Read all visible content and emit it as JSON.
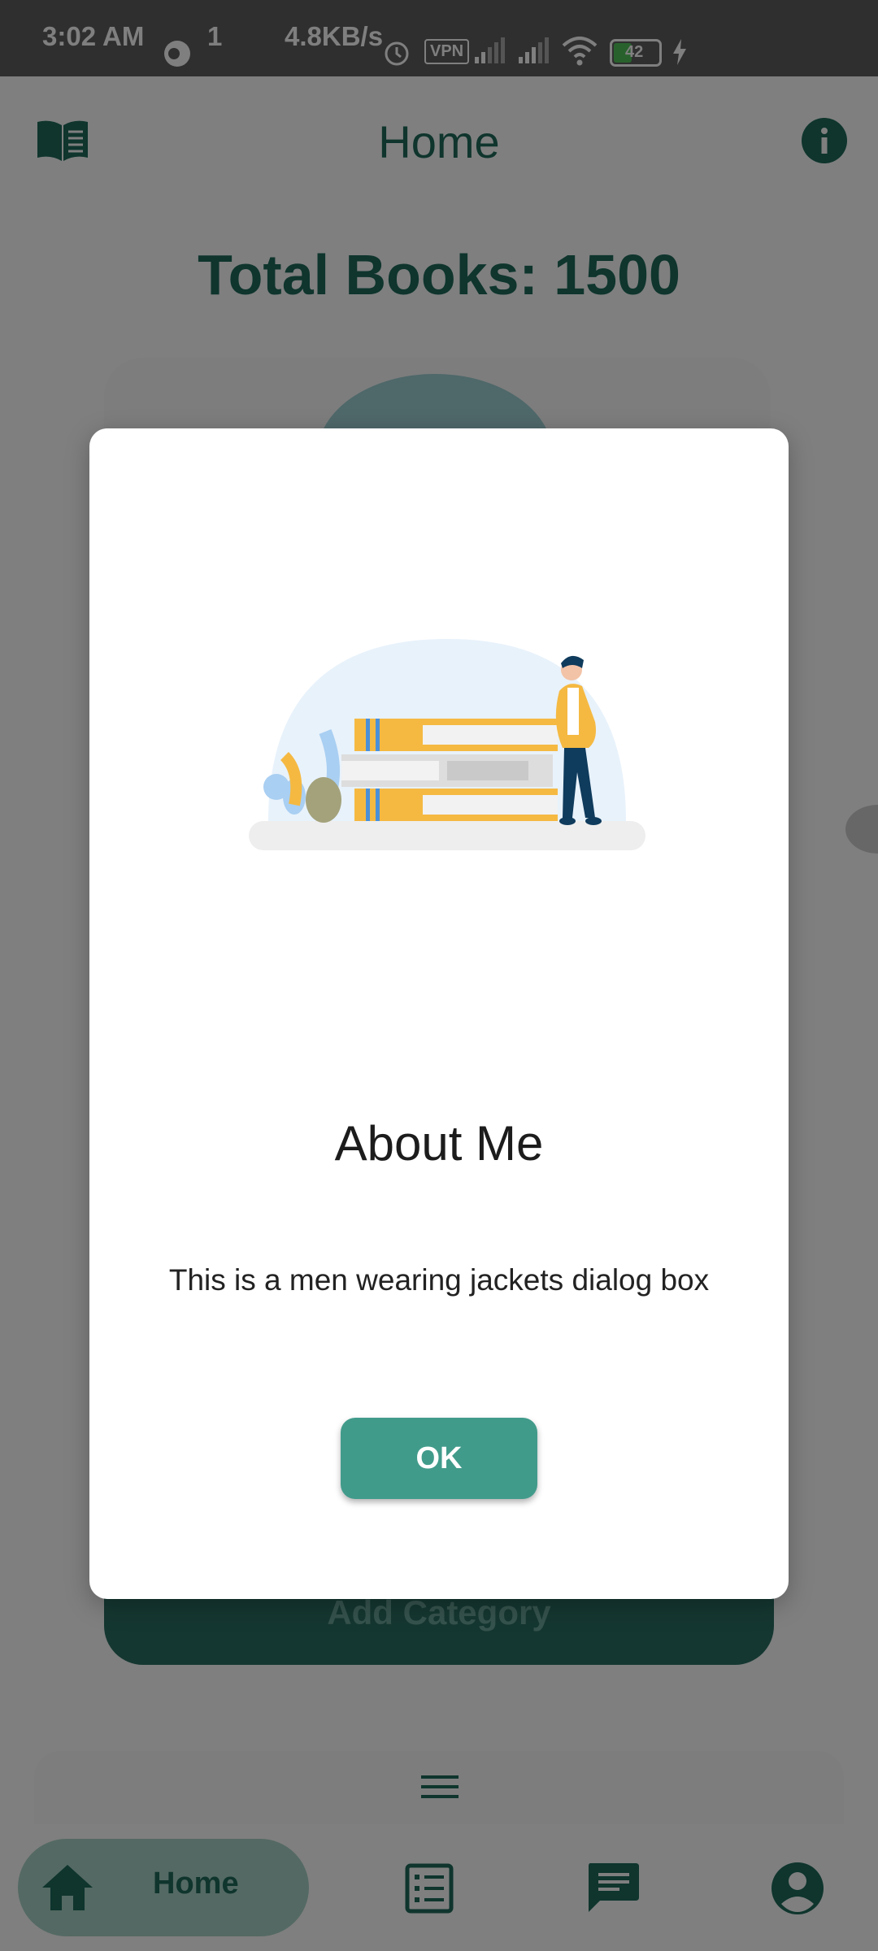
{
  "status_bar": {
    "time": "3:02 AM",
    "speed": "4.8KB/s",
    "vpn": "VPN",
    "battery": "42"
  },
  "appbar": {
    "title": "Home",
    "left_icon": "book-icon",
    "right_icon": "info-icon"
  },
  "main": {
    "total_books": "Total Books: 1500",
    "add_category_label": "Add Category"
  },
  "bottom_nav": {
    "items": [
      {
        "label": "Home",
        "icon": "home-icon",
        "active": true
      },
      {
        "label": "",
        "icon": "list-icon"
      },
      {
        "label": "",
        "icon": "chat-icon"
      },
      {
        "label": "",
        "icon": "account-icon"
      }
    ]
  },
  "dialog": {
    "title": "About Me",
    "message": "This is a men wearing jackets dialog box",
    "ok_label": "OK"
  },
  "colors": {
    "primary": "#1f6b5b",
    "button": "#419b8b",
    "accent_yellow": "#f5b942",
    "status_bar": "#5f5f5f"
  }
}
